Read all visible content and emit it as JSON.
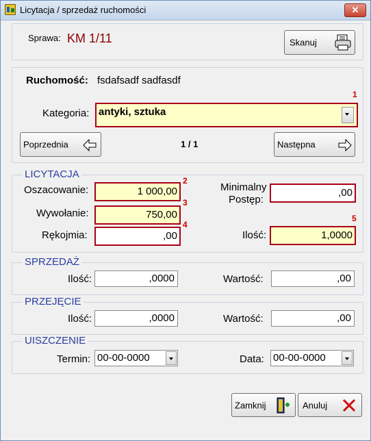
{
  "window": {
    "title": "Licytacja / sprzedaż ruchomości",
    "close": "✕"
  },
  "header": {
    "case_label": "Sprawa:",
    "case_value": "KM 1/11",
    "scan_label": "Skanuj"
  },
  "item": {
    "label": "Ruchomość:",
    "value": "fsdafsadf sadfasdf",
    "category_label": "Kategoria:",
    "category_value": "antyki, sztuka",
    "prev_label": "Poprzednia",
    "next_label": "Następna",
    "pager": "1 / 1"
  },
  "auction": {
    "title": "LICYTACJA",
    "valuation_label": "Oszacowanie:",
    "valuation_value": "1 000,00",
    "call_label": "Wywołanie:",
    "call_value": "750,00",
    "bond_label": "Rękojmia:",
    "bond_value": ",00",
    "min_step_label_1": "Minimalny",
    "min_step_label_2": "Postęp:",
    "min_step_value": ",00",
    "quantity_label": "Ilość:",
    "quantity_value": "1,0000"
  },
  "sale": {
    "title": "SPRZEDAŻ",
    "quantity_label": "Ilość:",
    "quantity_value": ",0000",
    "value_label": "Wartość:",
    "value_value": ",00"
  },
  "takeover": {
    "title": "PRZEJĘCIE",
    "quantity_label": "Ilość:",
    "quantity_value": ",0000",
    "value_label": "Wartość:",
    "value_value": ",00"
  },
  "payment": {
    "title": "UISZCZENIE",
    "term_label": "Termin:",
    "term_value": "00-00-0000",
    "date_label": "Data:",
    "date_value": "00-00-0000"
  },
  "markers": [
    "1",
    "2",
    "3",
    "4",
    "5"
  ],
  "footer": {
    "close_label": "Zamknij",
    "cancel_label": "Anuluj"
  },
  "colors": {
    "accent_red": "#a80018",
    "group_title": "#2b3da1",
    "field_yellow": "#ffffc8"
  }
}
